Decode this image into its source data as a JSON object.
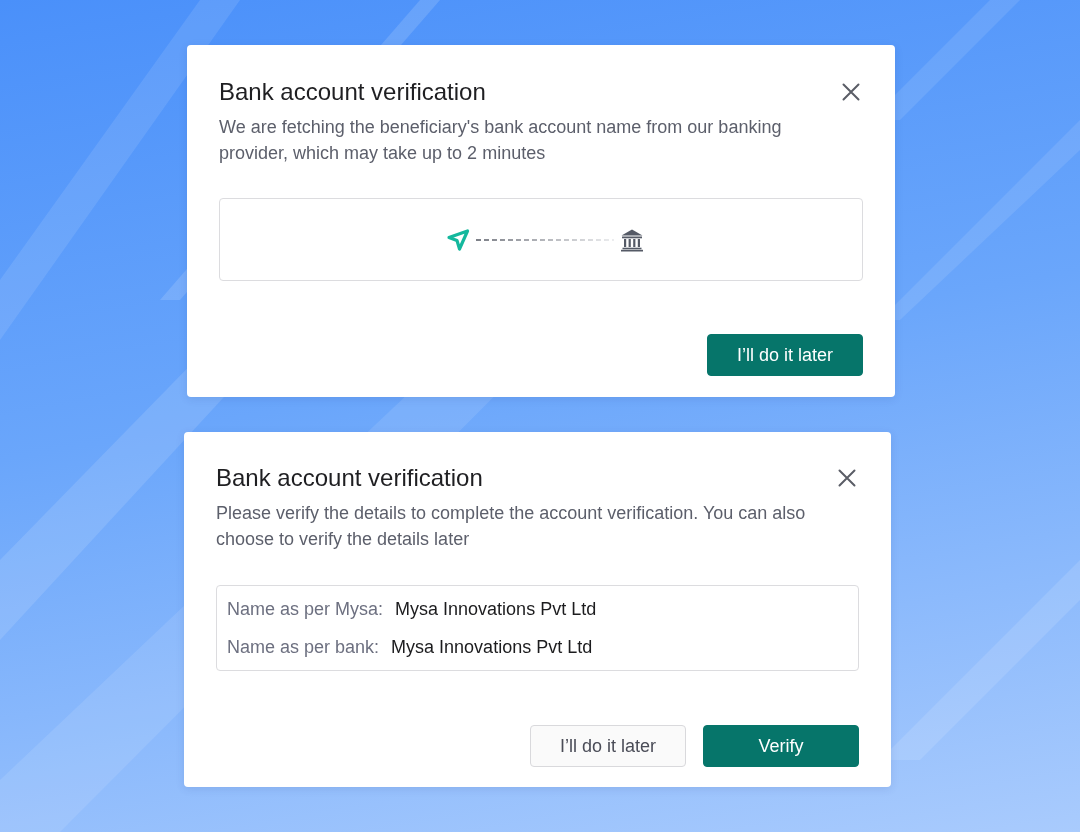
{
  "dialogs": [
    {
      "kind": "progress",
      "title": "Bank account verification",
      "description": "We are fetching the beneficiary's bank account name from our banking provider, which may take up to 2 minutes",
      "buttons": [
        {
          "label": "I’ll do it later",
          "kind": "primary"
        }
      ]
    },
    {
      "kind": "details",
      "title": "Bank account verification",
      "description": "Please verify the details to complete the account verification. You can also choose to verify the details later",
      "details": [
        {
          "label": "Name as per Mysa:",
          "value": "Mysa Innovations Pvt Ltd"
        },
        {
          "label": "Name as per bank:",
          "value": "Mysa Innovations Pvt Ltd"
        }
      ],
      "buttons": [
        {
          "label": "I’ll do it later",
          "kind": "secondary"
        },
        {
          "label": "Verify",
          "kind": "primary"
        }
      ]
    }
  ]
}
